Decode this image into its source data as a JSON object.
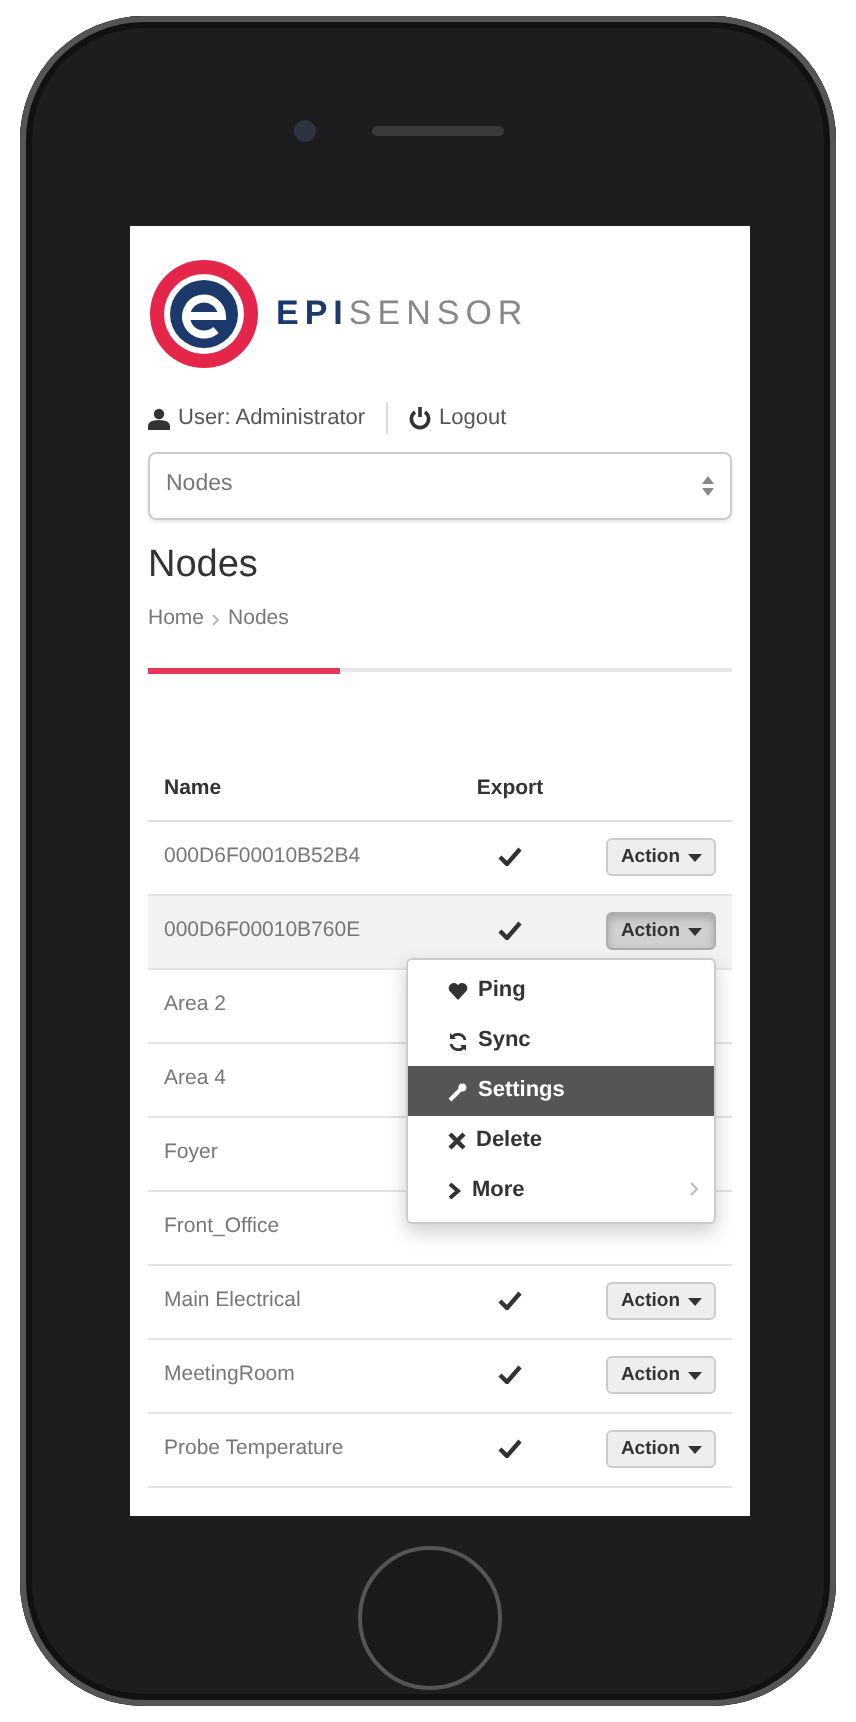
{
  "brand": {
    "prefix": "EPI",
    "suffix": "SENSOR"
  },
  "user_bar": {
    "user": "User: Administrator",
    "logout": "Logout"
  },
  "page_select": {
    "value": "Nodes"
  },
  "title": "Nodes",
  "breadcrumb": [
    "Home",
    "Nodes"
  ],
  "table": {
    "columns": [
      "Name",
      "Export"
    ],
    "rows": [
      {
        "name": "000D6F00010B52B4",
        "highlighted": false,
        "export_checked": true,
        "action": "Action",
        "menu_open": false
      },
      {
        "name": "000D6F00010B760E",
        "highlighted": true,
        "export_checked": true,
        "action": "Action",
        "menu_open": true
      },
      {
        "name": "Area 2",
        "highlighted": false
      },
      {
        "name": "Area 4",
        "highlighted": false
      },
      {
        "name": "Foyer",
        "highlighted": false
      },
      {
        "name": "Front_Office",
        "highlighted": false
      },
      {
        "name": "Main Electrical",
        "highlighted": false,
        "export_checked": true,
        "action": "Action",
        "menu_open": false
      },
      {
        "name": "MeetingRoom",
        "highlighted": false,
        "export_checked": true,
        "action": "Action",
        "menu_open": false
      },
      {
        "name": "Probe Temperature",
        "highlighted": false,
        "export_checked": true,
        "action": "Action",
        "menu_open": false
      }
    ]
  },
  "action_menu": {
    "items": [
      {
        "kind": "heart",
        "label": "Ping",
        "selected": false,
        "submenu": false
      },
      {
        "kind": "sync",
        "label": "Sync",
        "selected": false,
        "submenu": false
      },
      {
        "kind": "wrench",
        "label": "Settings",
        "selected": true,
        "submenu": false
      },
      {
        "kind": "cross",
        "label": "Delete",
        "selected": false,
        "submenu": false
      },
      {
        "kind": "chevron",
        "label": "More",
        "selected": false,
        "submenu": true
      }
    ]
  }
}
